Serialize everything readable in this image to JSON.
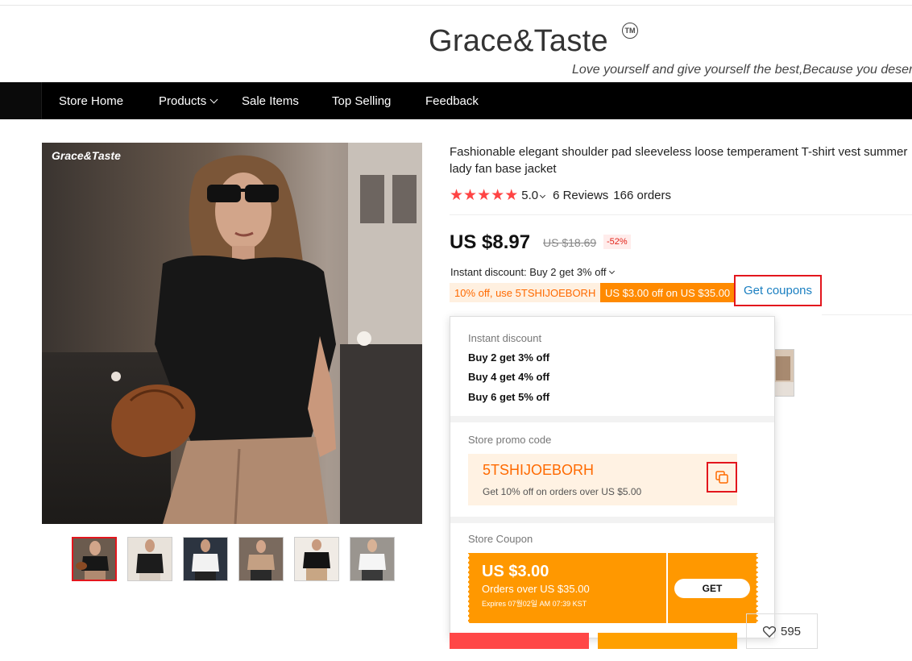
{
  "store": {
    "logo_text": "Grace&Taste",
    "tm_label": "TM",
    "tagline": "Love yourself and give yourself the best,Because you deserve it"
  },
  "nav": {
    "items": [
      {
        "label": "Store Home"
      },
      {
        "label": "Products"
      },
      {
        "label": "Sale Items"
      },
      {
        "label": "Top Selling"
      },
      {
        "label": "Feedback"
      }
    ]
  },
  "gallery": {
    "watermark": "Grace&Taste",
    "thumb_count": 6,
    "active_index": 0
  },
  "product": {
    "title_line1": "Fashionable elegant shoulder pad sleeveless loose temperament T-shirt vest summer",
    "title_line2": "lady fan base jacket",
    "rating": "5.0",
    "reviews": "6 Reviews",
    "orders": "166 orders",
    "price": "US $8.97",
    "old_price": "US $18.69",
    "discount_badge": "-52%",
    "instant_discount": "Instant discount: Buy 2 get 3% off",
    "tag_promo": "10% off, use 5TSHIJOEBORH",
    "tag_coupon": "US $3.00 off on US $35.00",
    "get_coupons": "Get coupons",
    "wishlist_count": "595"
  },
  "popup": {
    "instant_label": "Instant discount",
    "instant_items": [
      "Buy 2 get 3% off",
      "Buy 4 get 4% off",
      "Buy 6 get 5% off"
    ],
    "promo_label": "Store promo code",
    "promo_code": "5TSHIJOEBORH",
    "promo_desc": "Get 10% off on orders over US $5.00",
    "coupon_label": "Store Coupon",
    "coupon_amount": "US $3.00",
    "coupon_min": "Orders over US $35.00",
    "coupon_expiry": "Expires 07월02일 AM 07:39 KST",
    "get_label": "GET"
  },
  "colors": {
    "accent_red": "#e3161d",
    "accent_orange": "#ff9800",
    "promo_text": "#ff6a00",
    "link_blue": "#1a7fc1",
    "star": "#f44444"
  },
  "icons": {
    "copy": "copy-icon",
    "heart": "heart-icon",
    "chevron": "chevron-down-icon",
    "star": "star-icon"
  }
}
